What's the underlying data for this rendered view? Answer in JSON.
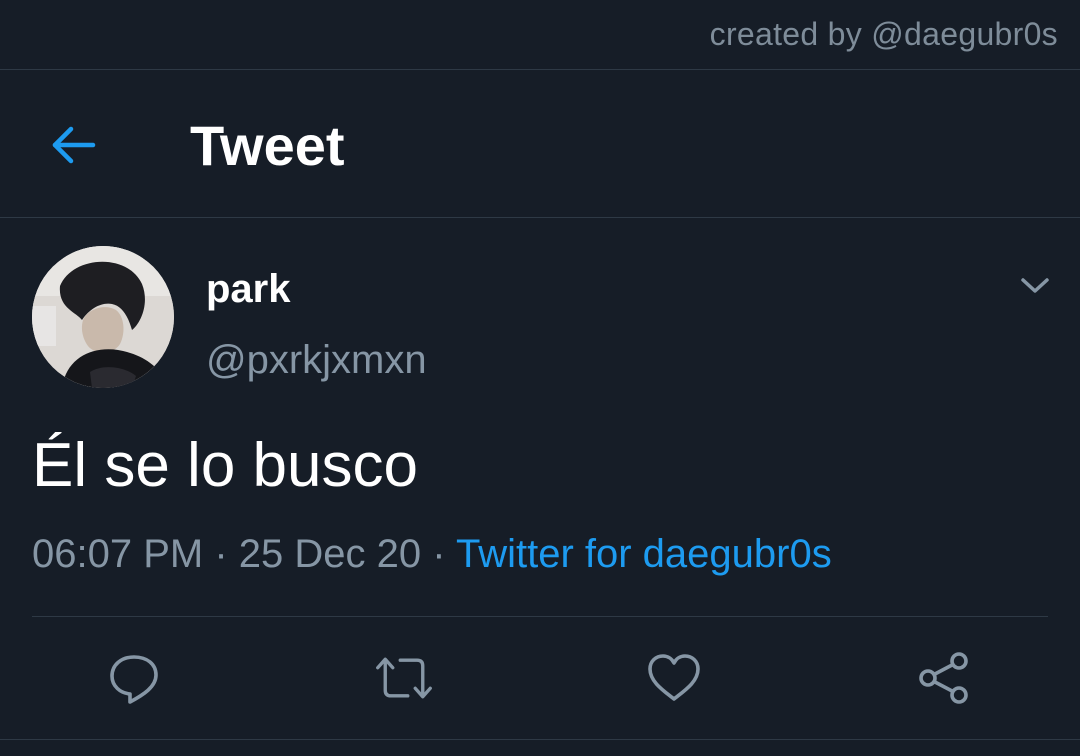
{
  "credit": {
    "text": "created by @daegubr0s"
  },
  "header": {
    "title": "Tweet",
    "back_icon": "arrow-left-icon",
    "accent_color": "#1d9bf0"
  },
  "tweet": {
    "author": {
      "display_name": "park",
      "handle": "@pxrkjxmxn",
      "avatar_icon": "avatar-photo"
    },
    "menu_icon": "chevron-down-icon",
    "text": "Él se lo busco",
    "time": "06:07 PM",
    "date": "25 Dec 20",
    "separator": "·",
    "source": "Twitter for daegubr0s"
  },
  "actions": [
    {
      "name": "reply",
      "icon": "reply-icon"
    },
    {
      "name": "retweet",
      "icon": "retweet-icon"
    },
    {
      "name": "like",
      "icon": "heart-icon"
    },
    {
      "name": "share",
      "icon": "share-icon"
    }
  ],
  "colors": {
    "background": "#161d27",
    "divider": "#2e3945",
    "secondary_text": "#8696a5",
    "link": "#1d9bf0"
  }
}
